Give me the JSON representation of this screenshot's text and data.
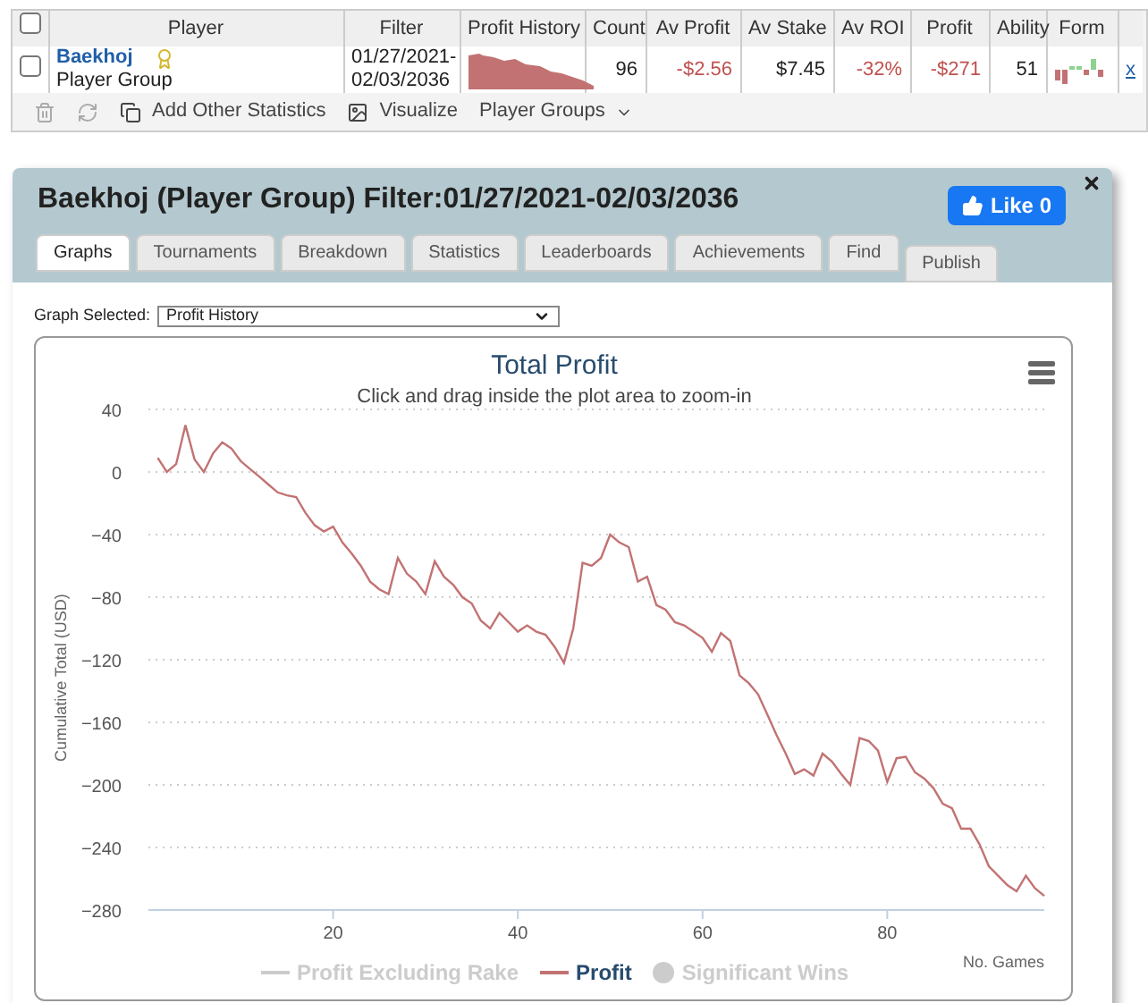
{
  "table": {
    "columns": [
      "Player",
      "Filter",
      "Profit History",
      "Count",
      "Av Profit",
      "Av Stake",
      "Av ROI",
      "Profit",
      "Ability",
      "Form"
    ],
    "rows": [
      {
        "checked": false,
        "player": "Baekhoj",
        "group": "Player Group",
        "filter": "01/27/2021-02/03/2036",
        "count": "96",
        "av_profit": "-$2.56",
        "av_stake": "$7.45",
        "av_roi": "-32%",
        "profit": "-$271",
        "ability": "51",
        "remove": "x"
      }
    ],
    "header_checked": false
  },
  "toolbar": {
    "items": [
      {
        "kind": "delete",
        "disabled": true
      },
      {
        "kind": "refresh",
        "disabled": true
      },
      {
        "kind": "add",
        "label": "Add Other Statistics"
      },
      {
        "kind": "visualize",
        "label": "Visualize"
      },
      {
        "kind": "menu",
        "label": "Player Groups"
      }
    ]
  },
  "dialog": {
    "title": "Baekhoj (Player Group) Filter:01/27/2021-02/03/2036",
    "like_button": "Like 0",
    "tabs": [
      {
        "label": "Graphs",
        "selected": true
      },
      {
        "label": "Tournaments",
        "selected": false
      },
      {
        "label": "Breakdown",
        "selected": false
      },
      {
        "label": "Statistics",
        "selected": false
      },
      {
        "label": "Leaderboards",
        "selected": false
      },
      {
        "label": "Achievements",
        "selected": false
      },
      {
        "label": "Find",
        "selected": false
      }
    ],
    "publish_tab": "Publish",
    "graph_select": {
      "label": "Graph Selected:",
      "value": "Profit History"
    },
    "chart": {
      "subtitle": "Click and drag inside the plot area to zoom-in",
      "legend": [
        {
          "label": "Profit Excluding Rake",
          "kind": "line",
          "visible": false
        },
        {
          "kind": "series",
          "visible": true
        },
        {
          "label": "Significant Wins",
          "kind": "dot",
          "visible": false
        }
      ],
      "chart_data": {
        "type": "line",
        "title": "Total Profit",
        "xlabel": "No. Games",
        "ylabel": "Cumulative Total (USD)",
        "grid": true,
        "xlim": [
          0,
          97
        ],
        "ylim": [
          -280,
          40
        ],
        "xticks": [
          20,
          40,
          60,
          80
        ],
        "yticks": [
          40,
          0,
          -40,
          -80,
          -120,
          -160,
          -200,
          -240,
          -280
        ],
        "x": [
          1,
          2,
          3,
          4,
          5,
          6,
          7,
          8,
          9,
          10,
          11,
          12,
          13,
          14,
          15,
          16,
          17,
          18,
          19,
          20,
          21,
          22,
          23,
          24,
          25,
          26,
          27,
          28,
          29,
          30,
          31,
          32,
          33,
          34,
          35,
          36,
          37,
          38,
          39,
          40,
          41,
          42,
          43,
          44,
          45,
          46,
          47,
          48,
          49,
          50,
          51,
          52,
          53,
          54,
          55,
          56,
          57,
          58,
          59,
          60,
          61,
          62,
          63,
          64,
          65,
          66,
          67,
          68,
          69,
          70,
          71,
          72,
          73,
          74,
          75,
          76,
          77,
          78,
          79,
          80,
          81,
          82,
          83,
          84,
          85,
          86,
          87,
          88,
          89,
          90,
          91,
          92,
          93,
          94,
          95,
          96,
          97
        ],
        "series": [
          {
            "name": "Profit",
            "color": "#c27272",
            "values": [
              9,
              0,
              5,
              30,
              8,
              0,
              12,
              19,
              15,
              7,
              2,
              -3,
              -8,
              -13,
              -15,
              -16,
              -26,
              -34,
              -38,
              -35,
              -45,
              -52,
              -60,
              -70,
              -75,
              -78,
              -55,
              -65,
              -70,
              -78,
              -57,
              -67,
              -72,
              -80,
              -84,
              -95,
              -100,
              -90,
              -96,
              -102,
              -98,
              -102,
              -104,
              -112,
              -122,
              -100,
              -58,
              -60,
              -55,
              -40,
              -45,
              -48,
              -70,
              -67,
              -85,
              -88,
              -96,
              -98,
              -102,
              -106,
              -115,
              -103,
              -108,
              -130,
              -135,
              -142,
              -155,
              -168,
              -180,
              -193,
              -190,
              -194,
              -180,
              -185,
              -193,
              -200,
              -170,
              -172,
              -178,
              -198,
              -183,
              -182,
              -192,
              -196,
              -202,
              -212,
              -215,
              -228,
              -228,
              -238,
              -252,
              -258,
              -264,
              -268,
              -258,
              -266,
              -271
            ]
          }
        ]
      }
    }
  }
}
